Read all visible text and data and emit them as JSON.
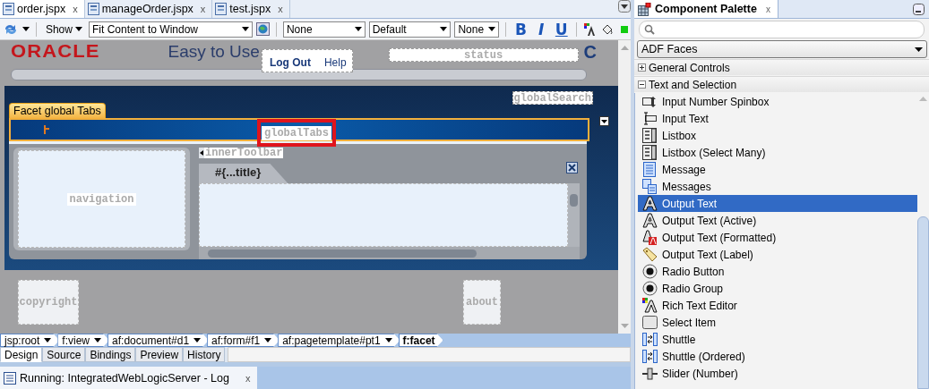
{
  "editor_tabs": [
    {
      "label": "order.jspx",
      "close": "x",
      "selected": true
    },
    {
      "label": "manageOrder.jspx",
      "close": "x",
      "selected": false
    },
    {
      "label": "test.jspx",
      "close": "x",
      "selected": false
    }
  ],
  "toolbar": {
    "show_label": "Show",
    "zoom": "Fit Content to Window",
    "style_class": "None",
    "font": "Default",
    "size": "None",
    "bold": "B",
    "italic": "I",
    "underline": "U"
  },
  "canvas": {
    "logo": "ORACLE",
    "app_title": "Easy to Use",
    "links": [
      "Log Out",
      "Help"
    ],
    "status": "status",
    "cut_letter": "C",
    "global_search": "globalSearch",
    "facet_tab": "Facet  global Tabs",
    "global_tabs": "globalTabs",
    "inner_toolbar": "innerToolbar",
    "panel_title": "#{...title}",
    "navigation": "navigation",
    "copyright": "copyright",
    "about": "about"
  },
  "breadcrumbs": [
    {
      "label": "jsp:root",
      "current": false
    },
    {
      "label": "f:view",
      "current": false
    },
    {
      "label": "af:document#d1",
      "current": false
    },
    {
      "label": "af:form#f1",
      "current": false
    },
    {
      "label": "af:pagetemplate#pt1",
      "current": false
    },
    {
      "label": "f:facet",
      "current": true
    }
  ],
  "view_tabs": [
    {
      "label": "Design",
      "selected": true
    },
    {
      "label": "Source",
      "selected": false
    },
    {
      "label": "Bindings",
      "selected": false
    },
    {
      "label": "Preview",
      "selected": false
    },
    {
      "label": "History",
      "selected": false
    }
  ],
  "log_tab": {
    "label": "Running: IntegratedWebLogicServer - Log",
    "close": "x"
  },
  "palette": {
    "title": "Component Palette",
    "close": "x",
    "library": "ADF Faces",
    "groups": [
      {
        "label": "General Controls",
        "expanded": false
      },
      {
        "label": "Text and Selection",
        "expanded": true
      }
    ],
    "items": [
      {
        "label": "Input Number Spinbox",
        "kind": "spinbox",
        "selected": false
      },
      {
        "label": "Input Text",
        "kind": "input",
        "selected": false
      },
      {
        "label": "Listbox",
        "kind": "listbox",
        "selected": false
      },
      {
        "label": "Listbox (Select Many)",
        "kind": "listbox",
        "selected": false
      },
      {
        "label": "Message",
        "kind": "message",
        "selected": false
      },
      {
        "label": "Messages",
        "kind": "messages",
        "selected": false
      },
      {
        "label": "Output Text",
        "kind": "text",
        "selected": true
      },
      {
        "label": "Output Text (Active)",
        "kind": "text",
        "selected": false
      },
      {
        "label": "Output Text (Formatted)",
        "kind": "formatted",
        "selected": false
      },
      {
        "label": "Output Text (Label)",
        "kind": "label",
        "selected": false
      },
      {
        "label": "Radio Button",
        "kind": "radio",
        "selected": false
      },
      {
        "label": "Radio Group",
        "kind": "radio",
        "selected": false
      },
      {
        "label": "Rich Text Editor",
        "kind": "rich",
        "selected": false
      },
      {
        "label": "Select Item",
        "kind": "select",
        "selected": false
      },
      {
        "label": "Shuttle",
        "kind": "shuttle",
        "selected": false
      },
      {
        "label": "Shuttle (Ordered)",
        "kind": "shuttle",
        "selected": false
      },
      {
        "label": "Slider (Number)",
        "kind": "slider",
        "selected": false
      }
    ]
  }
}
